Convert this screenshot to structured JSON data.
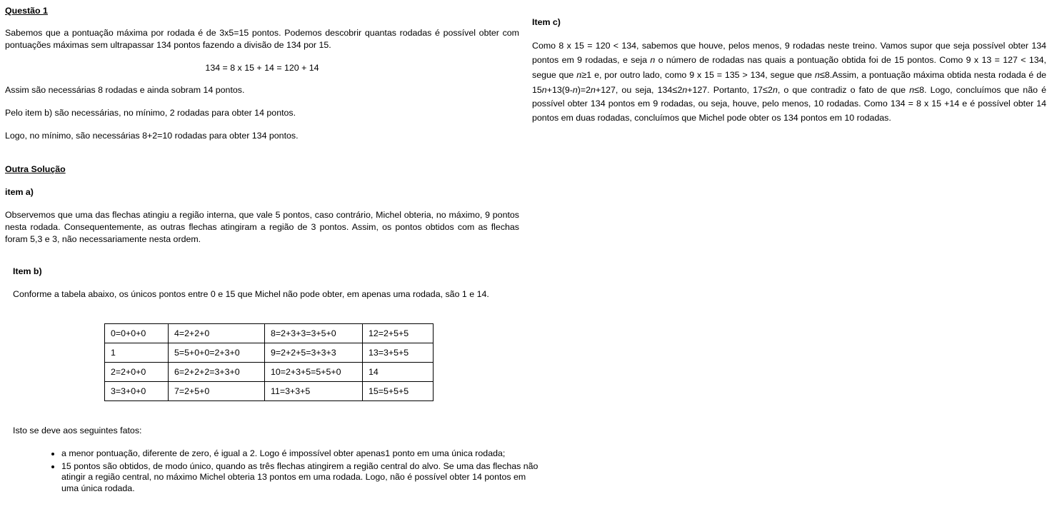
{
  "left": {
    "q1_title": "Questão 1",
    "p1": "Sabemos que a pontuação máxima por rodada é de 3x5=15 pontos. Podemos descobrir quantas rodadas é possível obter com pontuações máximas sem ultrapassar 134 pontos fazendo a divisão de 134 por 15.",
    "equation": "134 = 8 x 15 + 14 = 120 + 14",
    "p2": "Assim são necessárias 8 rodadas e ainda sobram 14 pontos.",
    "p3": "Pelo item b) são necessárias, no mínimo, 2 rodadas para obter 14 pontos.",
    "p4": "Logo, no mínimo, são necessárias 8+2=10 rodadas para obter 134 pontos.",
    "outra_title": "Outra Solução",
    "item_a_title": "item a)",
    "item_a_text": "Observemos que uma das flechas atingiu a região interna, que vale 5 pontos, caso contrário, Michel obteria, no máximo, 9 pontos nesta rodada. Consequentemente, as outras flechas atingiram a região de 3 pontos. Assim, os pontos obtidos com as flechas foram 5,3 e 3, não necessariamente nesta ordem.",
    "item_b_title": "Item b)",
    "item_b_text": "Conforme a tabela abaixo, os únicos pontos entre 0 e 15 que Michel não pode obter, em apenas uma rodada, são 1 e 14.",
    "table": [
      [
        "0=0+0+0",
        "4=2+2+0",
        "8=2+3+3=3+5+0",
        "12=2+5+5"
      ],
      [
        "1",
        "5=5+0+0=2+3+0",
        "9=2+2+5=3+3+3",
        "13=3+5+5"
      ],
      [
        "2=2+0+0",
        "6=2+2+2=3+3+0",
        "10=2+3+5=5+5+0",
        "14"
      ],
      [
        "3=3+0+0",
        "7=2+5+0",
        "11=3+3+5",
        "15=5+5+5"
      ]
    ],
    "facts_intro": "Isto se deve aos seguintes fatos:",
    "facts": [
      "a menor pontuação, diferente de zero, é igual a 2. Logo é impossível obter apenas1 ponto em uma única rodada;",
      "15 pontos são obtidos, de modo único, quando as três flechas atingirem a região central do alvo. Se uma das flechas não atingir a região central, no máximo Michel obteria 13 pontos em uma rodada. Logo, não é possível obter 14 pontos em uma única rodada."
    ]
  },
  "right": {
    "item_c_title": "Item c)",
    "s1": "Como 8 x 15 = 120 < 134, sabemos que houve, pelos menos, 9 rodadas neste treino. Vamos supor que seja possível obter 134 pontos em 9 rodadas, e seja ",
    "n": "n",
    "s2": " o número de rodadas nas quais a pontuação obtida foi de 15 pontos. Como 9 x 13 = 127 < 134, segue que ",
    "ge": "≥",
    "s3": "1 e, por outro lado, como 9 x 15 = 135 > 134, segue que ",
    "le": "≤",
    "s4": "8.Assim, a pontuação máxima obtida nesta rodada é de 15",
    "s5": "+13(9-",
    "s6": ")=2",
    "s7": "+127, ou seja, 134",
    "s8": "2",
    "s9": "+127. Portanto, 17",
    "s10": "2",
    "s11": ", o que contradiz o fato de que ",
    "s12": "8. Logo, concluímos que não é possível obter 134 pontos em 9 rodadas, ou seja, houve, pelo menos, 10 rodadas. Como 134 = 8 x 15 +14 e é possível obter 14 pontos em duas rodadas, concluímos que Michel pode obter os 134 pontos em 10 rodadas."
  }
}
